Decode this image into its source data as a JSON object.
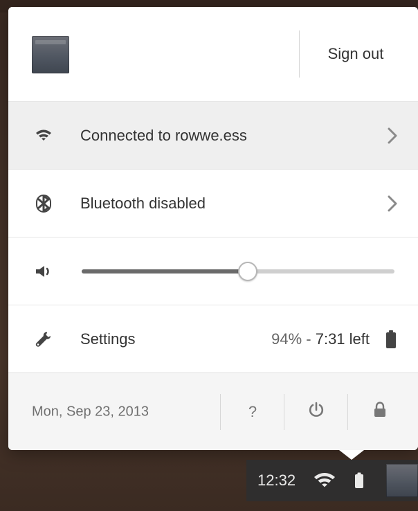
{
  "panel": {
    "header": {
      "sign_out_label": "Sign out",
      "avatar_icon": "user-avatar"
    },
    "rows": {
      "network": {
        "label": "Connected to rowwe.ess",
        "icon": "wifi-icon",
        "chevron_icon": "chevron-right-icon"
      },
      "bluetooth": {
        "label": "Bluetooth disabled",
        "icon": "bluetooth-icon",
        "chevron_icon": "chevron-right-icon"
      },
      "volume": {
        "icon": "speaker-icon",
        "level": 0.53
      },
      "settings": {
        "label": "Settings",
        "icon": "wrench-icon",
        "battery_percent": "94%",
        "battery_separator": " - ",
        "battery_time": "7:31 left",
        "battery_icon": "battery-icon"
      }
    },
    "footer": {
      "date": "Mon, Sep 23, 2013",
      "help_label": "?",
      "power_icon": "power-icon",
      "lock_icon": "lock-icon"
    }
  },
  "tray": {
    "clock": "12:32",
    "wifi_icon": "wifi-icon",
    "battery_icon": "battery-icon",
    "avatar_icon": "user-avatar"
  },
  "colors": {
    "panel_bg": "#ffffff",
    "selected_row_bg": "#efefef",
    "footer_bg": "#f5f5f5",
    "text_primary": "#333333",
    "text_secondary": "#6f6f6f",
    "tray_bg": "#2f2f2f"
  }
}
